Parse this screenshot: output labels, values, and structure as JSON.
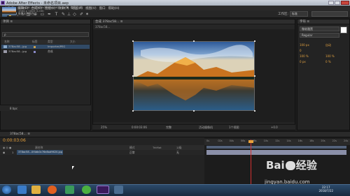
{
  "window": {
    "title": "Adobe After Effects - 未命名项目.aep"
  },
  "menu": [
    "文件(F)",
    "编辑(E)",
    "合成(C)",
    "图层(L)",
    "效果(T)",
    "动画(A)",
    "视图(V)",
    "窗口",
    "帮助(H)"
  ],
  "toolbar": {
    "workspace_label": "工作区:",
    "workspace_value": "标准",
    "search_placeholder": ""
  },
  "project": {
    "tab": "项目 ≡",
    "asset_name": "378ac58...a2f4b8fc76e8ad9620.jpg ▼, 使用了1次",
    "asset_dims": "1500 x 1000 (1.00)",
    "asset_depth": "数百万种颜色",
    "search_placeholder": "ρ",
    "col_name": "名称",
    "col_label": "标签",
    "col_type": "类型",
    "col_size": "大小",
    "rows": [
      {
        "name": "378ac58...jpg",
        "type": "ImporterJPEG",
        "size": ""
      },
      {
        "name": "378ac58...jpg",
        "type": "合成",
        "size": ""
      }
    ],
    "footer_bpc": "8 bpc"
  },
  "comp": {
    "tab": "合成 378ac58... ≡",
    "breadcrumb": "378ac58...",
    "footer_zoom": "25%",
    "footer_time": "0:00:03:06",
    "footer_quality": "完整",
    "footer_camera": "活动摄像机",
    "footer_views": "1个视图",
    "footer_offset": "+0.0"
  },
  "right": {
    "tab": "字符 ≡",
    "font": "微软雅黑",
    "style": "Regular",
    "size": "100 px",
    "leading": "自动",
    "tracking": "0",
    "scale_v": "100 %",
    "scale_h": "100 %",
    "baseline": "0 px",
    "tsume": "0 %"
  },
  "timeline": {
    "tab": "378ac58... ≡",
    "timecode": "0:00:03:06",
    "col_source": "源名称",
    "col_mode": "模式",
    "col_trkmat": "TrkMat",
    "col_parent": "父级",
    "layer_index": "1",
    "layer_name": "378ac58...0f4db0c76e8ad9620.jpg",
    "layer_mode": "正常",
    "layer_parent": "无",
    "ruler_ticks": [
      "0s",
      "02s",
      "04s",
      "06s",
      "08s",
      "10s",
      "12s",
      "14s",
      "16s",
      "18s",
      "20s",
      "22s",
      "24s"
    ],
    "playhead_time": 3.2,
    "duration": 30
  },
  "taskbar": {
    "time": "22:17",
    "date": "2018/7/22"
  },
  "watermark": {
    "brand": "Bai",
    "brand2": "经验",
    "url": "jingyan.baidu.com"
  }
}
